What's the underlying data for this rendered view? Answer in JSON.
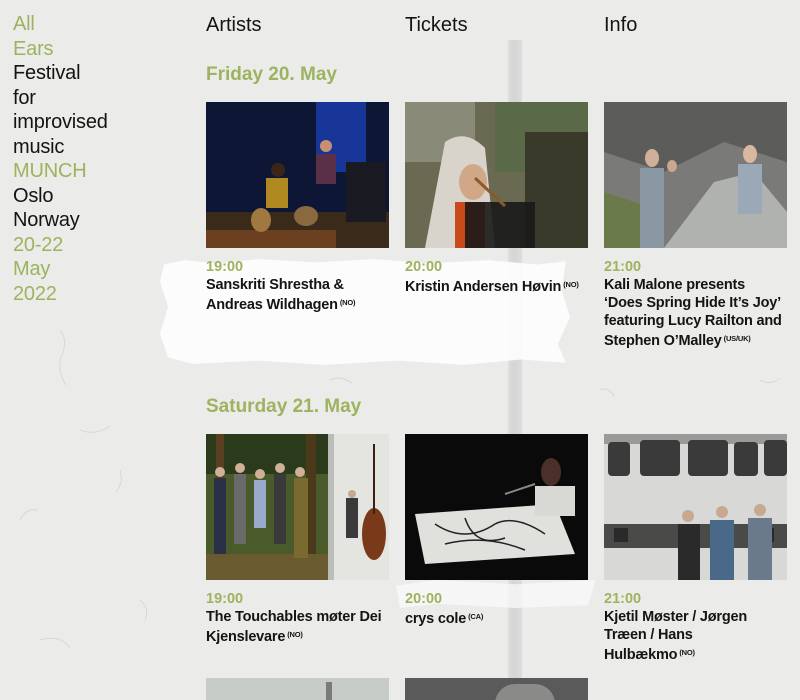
{
  "sidebar": {
    "lines": [
      {
        "text": "All",
        "green": true
      },
      {
        "text": "Ears",
        "green": true
      },
      {
        "text": "Festival",
        "green": false
      },
      {
        "text": "for",
        "green": false
      },
      {
        "text": "improvised",
        "green": false
      },
      {
        "text": "music",
        "green": false
      },
      {
        "text": "MUNCH",
        "green": true
      },
      {
        "text": "Oslo",
        "green": false
      },
      {
        "text": "Norway",
        "green": false
      },
      {
        "text": "20-22",
        "green": true
      },
      {
        "text": "May",
        "green": true
      },
      {
        "text": "2022",
        "green": true
      }
    ]
  },
  "nav": {
    "artists": "Artists",
    "tickets": "Tickets",
    "info": "Info"
  },
  "days": [
    {
      "title": "Friday 20. May",
      "events": [
        {
          "time": "19:00",
          "name": "Sanskriti Shrestha & Andreas Wildhagen",
          "tag": "(NO)",
          "photo": "tabla-duo-concert-photo"
        },
        {
          "time": "20:00",
          "name": "Kristin Andersen Høvin",
          "tag": "(NO)",
          "photo": "flute-player-forest-photo"
        },
        {
          "time": "21:00",
          "name": "Kali Malone presents ‘Does Spring Hide It’s Joy’ featuring Lucy Railton and Stephen O’Malley",
          "tag": "(US/UK)",
          "photo": "trio-on-rocks-photo"
        }
      ]
    },
    {
      "title": "Saturday 21. May",
      "events": [
        {
          "time": "19:00",
          "name": "The Touchables møter Dei Kjenslevare",
          "tag": "(NO)",
          "photo": "group-in-forest-photo"
        },
        {
          "time": "20:00",
          "name": "crys cole",
          "tag": "(CA)",
          "photo": "electronics-table-photo"
        },
        {
          "time": "21:00",
          "name": "Kjetil Møster / Jørgen Træen / Hans Hulbækmo",
          "tag": "(NO)",
          "photo": "trio-by-train-photo"
        }
      ]
    }
  ],
  "colors": {
    "accent": "#9cb35f",
    "text": "#141414",
    "background": "#ebebea"
  }
}
